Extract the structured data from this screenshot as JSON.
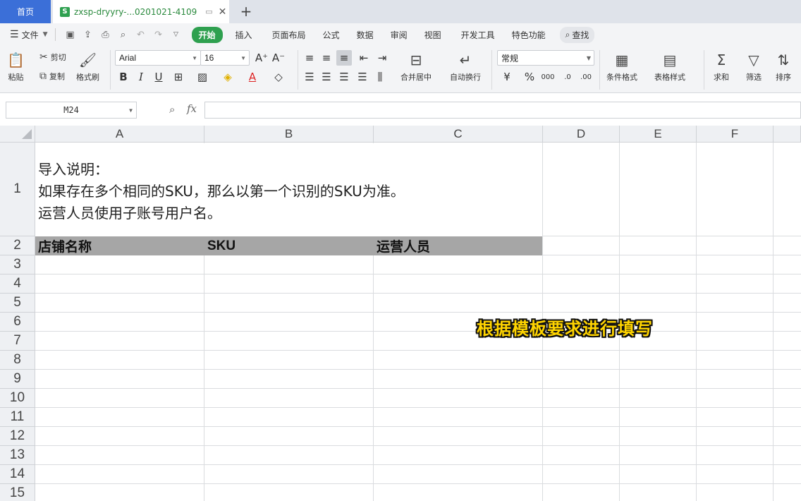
{
  "tabs": {
    "home_label": "首页",
    "doc_title": "zxsp-dryyry-...0201021-4109",
    "doc_icon_letter": "S"
  },
  "menu": {
    "file_label": "文件",
    "items": [
      "开始",
      "插入",
      "页面布局",
      "公式",
      "数据",
      "审阅",
      "视图",
      "开发工具",
      "特色功能"
    ],
    "search_label": "查找",
    "accent": "#2ea04f"
  },
  "ribbon": {
    "paste": "粘贴",
    "cut": "剪切",
    "copy": "复制",
    "format_painter": "格式刷",
    "font_name": "Arial",
    "font_size": "16",
    "merge_center": "合并居中",
    "wrap_text": "自动换行",
    "number_format": "常规",
    "conditional_format": "条件格式",
    "table_style": "表格样式",
    "sum": "求和",
    "filter": "筛选",
    "sort": "排序"
  },
  "formula_bar": {
    "cell_ref": "M24",
    "fx": "fx",
    "value": ""
  },
  "grid": {
    "columns": [
      "A",
      "B",
      "C",
      "D",
      "E",
      "F"
    ],
    "rows": [
      "1",
      "2",
      "3",
      "4",
      "5",
      "6",
      "7",
      "8",
      "9",
      "10",
      "11",
      "12",
      "13",
      "14",
      "15"
    ],
    "a1_lines": [
      "导入说明：",
      "如果存在多个相同的SKU，那么以第一个识别的SKU为准。",
      "运营人员使用子账号用户名。"
    ],
    "header_cells": [
      "店铺名称",
      "SKU",
      "运营人员"
    ],
    "header_fill": "#a6a6a6"
  },
  "overlay": {
    "caption": "根据模板要求进行填写",
    "color": "#ffd400"
  }
}
